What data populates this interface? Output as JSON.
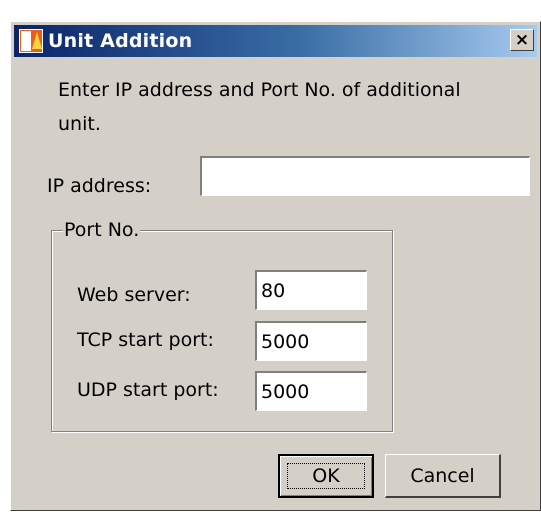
{
  "dialog": {
    "title": "Unit Addition",
    "close_glyph": "×",
    "instruction": "Enter IP address and Port No. of additional unit.",
    "ip": {
      "label": "IP address:",
      "value": ""
    },
    "port_group": {
      "legend": "Port No.",
      "web_server": {
        "label": "Web server:",
        "value": "80"
      },
      "tcp_start": {
        "label": "TCP start port:",
        "value": "5000"
      },
      "udp_start": {
        "label": "UDP start port:",
        "value": "5000"
      }
    },
    "buttons": {
      "ok": "OK",
      "cancel": "Cancel"
    }
  },
  "icons": {
    "app": "pa-app-icon",
    "close": "close-icon"
  },
  "colors": {
    "titlebar_start": "#0a246a",
    "titlebar_end": "#a6caf0",
    "dialog_bg": "#d4d0c8"
  }
}
